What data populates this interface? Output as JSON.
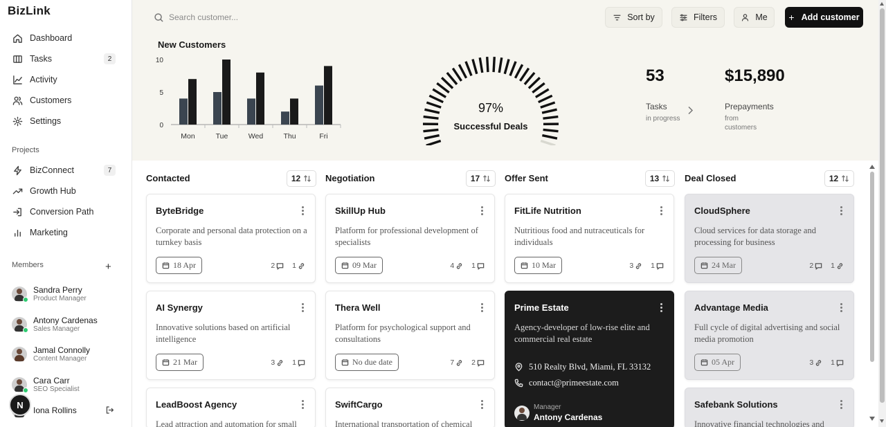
{
  "app": {
    "brand": "BizLink"
  },
  "sidebar": {
    "nav": [
      {
        "label": "Dashboard",
        "icon": "home-icon"
      },
      {
        "label": "Tasks",
        "icon": "tasks-icon",
        "badge": "2"
      },
      {
        "label": "Activity",
        "icon": "activity-icon"
      },
      {
        "label": "Customers",
        "icon": "users-icon"
      },
      {
        "label": "Settings",
        "icon": "gear-icon"
      }
    ],
    "projects_label": "Projects",
    "projects": [
      {
        "label": "BizConnect",
        "icon": "bolt-icon",
        "badge": "7"
      },
      {
        "label": "Growth Hub",
        "icon": "trend-icon"
      },
      {
        "label": "Conversion Path",
        "icon": "login-icon"
      },
      {
        "label": "Marketing",
        "icon": "bar-chart-icon"
      }
    ],
    "members_label": "Members",
    "members": [
      {
        "name": "Sandra Perry",
        "role": "Product Manager",
        "online": true
      },
      {
        "name": "Antony Cardenas",
        "role": "Sales Manager",
        "online": true
      },
      {
        "name": "Jamal Connolly",
        "role": "Content Manager",
        "online": false
      },
      {
        "name": "Cara Carr",
        "role": "SEO Specialist",
        "online": true
      },
      {
        "name": "Iona Rollins",
        "role": "",
        "online": false
      }
    ],
    "user_initial": "N"
  },
  "toolbar": {
    "search_placeholder": "Search customer...",
    "sort_label": "Sort by",
    "filters_label": "Filters",
    "me_label": "Me",
    "add_label": "Add customer"
  },
  "chart_data": {
    "type": "bar",
    "title": "New Customers",
    "categories": [
      "Mon",
      "Tue",
      "Wed",
      "Thu",
      "Fri"
    ],
    "series": [
      {
        "values": [
          4,
          5,
          4,
          2,
          6
        ],
        "color": "#3b4550"
      },
      {
        "values": [
          7,
          10,
          8,
          4,
          9
        ],
        "color": "#1a1a1a"
      }
    ],
    "yticks": [
      0,
      5,
      10
    ],
    "ylim": [
      0,
      10
    ]
  },
  "gauge": {
    "percent": "97%",
    "value": 97,
    "label": "Successful Deals"
  },
  "kpis": [
    {
      "value": "53",
      "label": "Tasks",
      "sub": "in progress"
    },
    {
      "value": "$15,890",
      "label": "Prepayments",
      "sub": "from customers"
    }
  ],
  "board": {
    "columns": [
      {
        "title": "Contacted",
        "count": "12"
      },
      {
        "title": "Negotiation",
        "count": "17"
      },
      {
        "title": "Offer Sent",
        "count": "13"
      },
      {
        "title": "Deal Closed",
        "count": "12"
      }
    ],
    "cards": [
      {
        "title": "ByteBridge",
        "desc": "Corporate and personal data protection on a turnkey basis",
        "date": "18 Apr",
        "s1": "2",
        "s2": "1"
      },
      {
        "title": "SkillUp Hub",
        "desc": "Platform for professional development of specialists",
        "date": "09 Mar",
        "s1": "4",
        "s2": "1"
      },
      {
        "title": "FitLife Nutrition",
        "desc": "Nutritious food and nutraceuticals for individuals",
        "date": "10 Mar",
        "s1": "3",
        "s2": "1"
      },
      {
        "title": "CloudSphere",
        "desc": "Cloud services for data storage and processing for business",
        "date": "24 Mar",
        "s1": "2",
        "s2": "1"
      },
      {
        "title": "AI Synergy",
        "desc": "Innovative solutions based on artificial intelligence",
        "date": "21 Mar",
        "s1": "3",
        "s2": "1"
      },
      {
        "title": "Thera Well",
        "desc": "Platform for psychological support and consultations",
        "date": "No due date",
        "s1": "7",
        "s2": "2"
      },
      {
        "title": "Prime Estate",
        "desc": "Agency-developer of low-rise elite and commercial real estate",
        "address": "510 Realty Blvd, Miami, FL 33132",
        "email": "contact@primeestate.com",
        "manager_label": "Manager",
        "manager": "Antony Cardenas"
      },
      {
        "title": "Advantage Media",
        "desc": "Full cycle of digital advertising and social media promotion",
        "date": "05 Apr",
        "s1": "3",
        "s2": "1"
      },
      {
        "title": "LeadBoost Agency",
        "desc": "Lead attraction and automation for small"
      },
      {
        "title": "SwiftCargo",
        "desc": "International transportation of chemical"
      },
      {
        "title": "Safebank Solutions",
        "desc": "Innovative financial technologies and"
      }
    ]
  }
}
